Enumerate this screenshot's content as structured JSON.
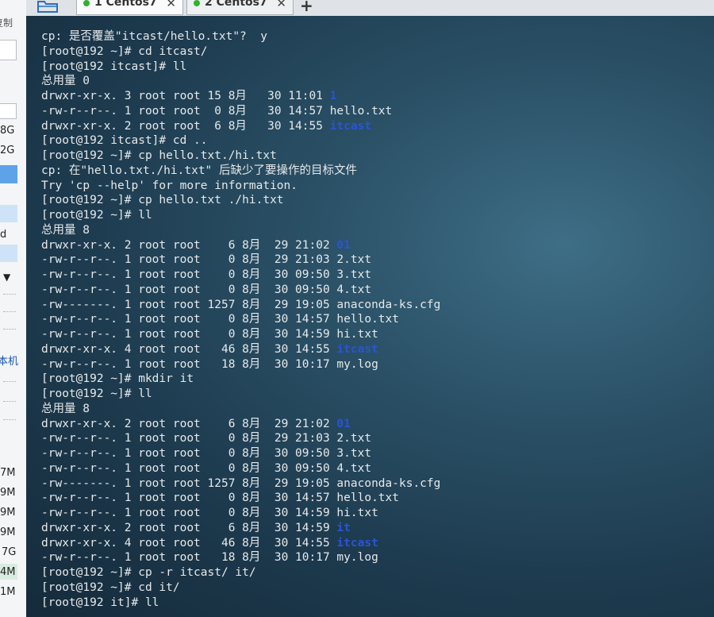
{
  "tabs": [
    {
      "label": "1 Centos7",
      "active": true,
      "status_color": "#2fb32f"
    },
    {
      "label": "2 Centos7",
      "active": false,
      "status_color": "#2fb32f"
    }
  ],
  "left_panel": {
    "top_text": "复制",
    "values": [
      "8G",
      "2G",
      "d",
      "本机",
      "7M",
      "9M",
      "9M",
      "9M",
      "7G",
      "4M",
      "1M"
    ]
  },
  "terminal": {
    "dir_color": "#2a54d6",
    "lines": [
      [
        {
          "t": "cp: 是否覆盖\"itcast/hello.txt\"?  y"
        }
      ],
      [
        {
          "t": "[root@192 ~]# cd itcast/"
        }
      ],
      [
        {
          "t": "[root@192 itcast]# ll"
        }
      ],
      [
        {
          "t": "总用量 0"
        }
      ],
      [
        {
          "t": "drwxr-xr-x. 3 root root 15 8月   30 11:01 "
        },
        {
          "t": "1",
          "dir": true
        }
      ],
      [
        {
          "t": "-rw-r--r--. 1 root root  0 8月   30 14:57 hello.txt"
        }
      ],
      [
        {
          "t": "drwxr-xr-x. 2 root root  6 8月   30 14:55 "
        },
        {
          "t": "itcast",
          "dir": true
        }
      ],
      [
        {
          "t": "[root@192 itcast]# cd .."
        }
      ],
      [
        {
          "t": "[root@192 ~]# cp hello.txt./hi.txt"
        }
      ],
      [
        {
          "t": "cp: 在\"hello.txt./hi.txt\" 后缺少了要操作的目标文件"
        }
      ],
      [
        {
          "t": "Try 'cp --help' for more information."
        }
      ],
      [
        {
          "t": "[root@192 ~]# cp hello.txt ./hi.txt"
        }
      ],
      [
        {
          "t": "[root@192 ~]# ll"
        }
      ],
      [
        {
          "t": "总用量 8"
        }
      ],
      [
        {
          "t": "drwxr-xr-x. 2 root root    6 8月  29 21:02 "
        },
        {
          "t": "01",
          "dir": true
        }
      ],
      [
        {
          "t": "-rw-r--r--. 1 root root    0 8月  29 21:03 2.txt"
        }
      ],
      [
        {
          "t": "-rw-r--r--. 1 root root    0 8月  30 09:50 3.txt"
        }
      ],
      [
        {
          "t": "-rw-r--r--. 1 root root    0 8月  30 09:50 4.txt"
        }
      ],
      [
        {
          "t": "-rw-------. 1 root root 1257 8月  29 19:05 anaconda-ks.cfg"
        }
      ],
      [
        {
          "t": "-rw-r--r--. 1 root root    0 8月  30 14:57 hello.txt"
        }
      ],
      [
        {
          "t": "-rw-r--r--. 1 root root    0 8月  30 14:59 hi.txt"
        }
      ],
      [
        {
          "t": "drwxr-xr-x. 4 root root   46 8月  30 14:55 "
        },
        {
          "t": "itcast",
          "dir": true
        }
      ],
      [
        {
          "t": "-rw-r--r--. 1 root root   18 8月  30 10:17 my.log"
        }
      ],
      [
        {
          "t": "[root@192 ~]# mkdir it"
        }
      ],
      [
        {
          "t": "[root@192 ~]# ll"
        }
      ],
      [
        {
          "t": "总用量 8"
        }
      ],
      [
        {
          "t": "drwxr-xr-x. 2 root root    6 8月  29 21:02 "
        },
        {
          "t": "01",
          "dir": true
        }
      ],
      [
        {
          "t": "-rw-r--r--. 1 root root    0 8月  29 21:03 2.txt"
        }
      ],
      [
        {
          "t": "-rw-r--r--. 1 root root    0 8月  30 09:50 3.txt"
        }
      ],
      [
        {
          "t": "-rw-r--r--. 1 root root    0 8月  30 09:50 4.txt"
        }
      ],
      [
        {
          "t": "-rw-------. 1 root root 1257 8月  29 19:05 anaconda-ks.cfg"
        }
      ],
      [
        {
          "t": "-rw-r--r--. 1 root root    0 8月  30 14:57 hello.txt"
        }
      ],
      [
        {
          "t": "-rw-r--r--. 1 root root    0 8月  30 14:59 hi.txt"
        }
      ],
      [
        {
          "t": "drwxr-xr-x. 2 root root    6 8月  30 14:59 "
        },
        {
          "t": "it",
          "dir": true
        }
      ],
      [
        {
          "t": "drwxr-xr-x. 4 root root   46 8月  30 14:55 "
        },
        {
          "t": "itcast",
          "dir": true
        }
      ],
      [
        {
          "t": "-rw-r--r--. 1 root root   18 8月  30 10:17 my.log"
        }
      ],
      [
        {
          "t": "[root@192 ~]# cp -r itcast/ it/"
        }
      ],
      [
        {
          "t": "[root@192 ~]# cd it/"
        }
      ],
      [
        {
          "t": "[root@192 it]# ll"
        }
      ]
    ]
  }
}
